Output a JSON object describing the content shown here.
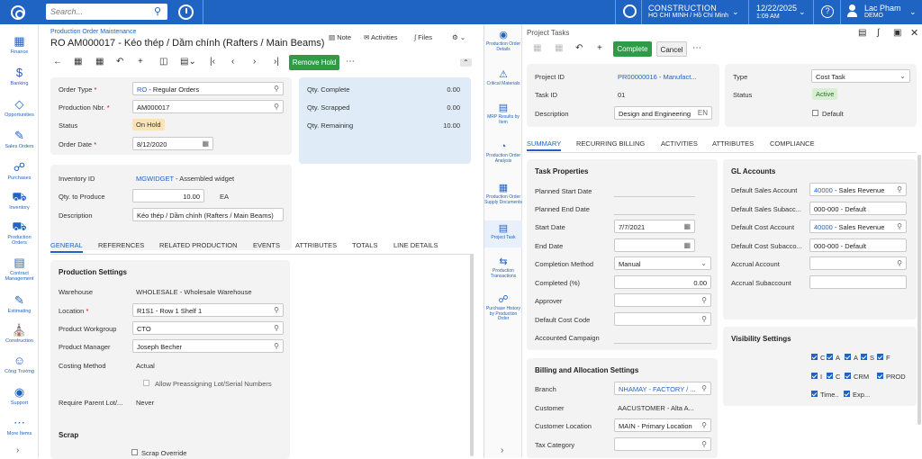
{
  "topbar": {
    "search_placeholder": "Search...",
    "company": "CONSTRUCTION",
    "branch": "HO CHI MINH / Hồ Chí Minh",
    "date": "12/22/2025",
    "time": "1:09 AM",
    "user_name": "Lac Pham",
    "user_role": "DEMO"
  },
  "sidebar": [
    {
      "label": "Finance",
      "icon": "finance-icon"
    },
    {
      "label": "Banking",
      "icon": "banking-icon"
    },
    {
      "label": "Opportunities",
      "icon": "opportunities-icon"
    },
    {
      "label": "Sales Orders",
      "icon": "sales-orders-icon"
    },
    {
      "label": "Purchases",
      "icon": "purchases-icon"
    },
    {
      "label": "Inventory",
      "icon": "inventory-icon"
    },
    {
      "label": "Production Orders",
      "icon": "production-orders-icon"
    },
    {
      "label": "Contract Management",
      "icon": "contract-icon"
    },
    {
      "label": "Estimating",
      "icon": "estimating-icon"
    },
    {
      "label": "Construction",
      "icon": "construction-icon"
    },
    {
      "label": "Công Trường",
      "icon": "site-icon"
    },
    {
      "label": "Support",
      "icon": "support-icon"
    },
    {
      "label": "More Items",
      "icon": "more-items-icon"
    }
  ],
  "main": {
    "breadcrumb": "Production Order Maintenance",
    "title": "RO AM000017 - Kéo thép / Dầm chính (Rafters / Main Beams)",
    "note_label": "Note",
    "activities_label": "Activities",
    "files_label": "Files",
    "remove_hold_label": "Remove Hold",
    "order_type_label": "Order Type",
    "order_type_code": "RO",
    "order_type_desc": " - Regular Orders",
    "production_nbr_label": "Production Nbr.",
    "production_nbr": "AM000017",
    "status_label": "Status",
    "status": "On Hold",
    "order_date_label": "Order Date",
    "order_date": "8/12/2020",
    "qty_complete_label": "Qty. Complete",
    "qty_complete": "0.00",
    "qty_scrapped_label": "Qty. Scrapped",
    "qty_scrapped": "0.00",
    "qty_remaining_label": "Qty. Remaining",
    "qty_remaining": "10.00",
    "inventory_id_label": "Inventory ID",
    "inventory_id_code": "MGWIDGET",
    "inventory_id_desc": " - Assembled widget",
    "qty_to_produce_label": "Qty. to Produce",
    "qty_to_produce": "10.00",
    "uom": "EA",
    "description_label": "Description",
    "description": "Kéo thép / Dầm chính (Rafters / Main Beams)",
    "tabs": [
      "GENERAL",
      "REFERENCES",
      "RELATED PRODUCTION",
      "EVENTS",
      "ATTRIBUTES",
      "TOTALS",
      "LINE DETAILS"
    ],
    "production_settings_title": "Production Settings",
    "warehouse_label": "Warehouse",
    "warehouse": "WHOLESALE - Wholesale Warehouse",
    "location_label": "Location",
    "location": "R1S1 - Row 1 Shelf 1",
    "product_workgroup_label": "Product Workgroup",
    "product_workgroup": "CTO",
    "product_manager_label": "Product Manager",
    "product_manager": "Joseph Becher",
    "costing_method_label": "Costing Method",
    "costing_method": "Actual",
    "allow_preassign_label": "Allow Preassigning Lot/Serial Numbers",
    "require_parent_label": "Require Parent Lot/...",
    "require_parent": "Never",
    "scrap_title": "Scrap",
    "scrap_override_label": "Scrap Override"
  },
  "rail": [
    {
      "label": "Production Order Details",
      "icon": "eye-icon"
    },
    {
      "label": "Critical Materials",
      "icon": "alert-icon"
    },
    {
      "label": "MRP Results by Item",
      "icon": "document-icon"
    },
    {
      "label": "Production Order Analysis",
      "icon": "gauge-icon"
    },
    {
      "label": "Production Order Supply Documents",
      "icon": "tree-icon"
    },
    {
      "label": "Project Task",
      "icon": "project-task-icon"
    },
    {
      "label": "Production Transactions",
      "icon": "transfer-icon"
    },
    {
      "label": "Purchase History by Production Order",
      "icon": "cart-icon"
    }
  ],
  "panel": {
    "title": "Project Tasks",
    "complete_label": "Complete",
    "cancel_label": "Cancel",
    "project_id_label": "Project ID",
    "project_id": "PR00000016 - Manufact...",
    "task_id_label": "Task ID",
    "task_id": "01",
    "description_label": "Description",
    "description": "Design and Engineering",
    "lang": "EN",
    "type_label": "Type",
    "type": "Cost Task",
    "status_label": "Status",
    "status": "Active",
    "default_label": "Default",
    "tabs": [
      "SUMMARY",
      "RECURRING BILLING",
      "ACTIVITIES",
      "ATTRIBUTES",
      "COMPLIANCE"
    ],
    "task_properties_title": "Task Properties",
    "planned_start_label": "Planned Start Date",
    "planned_end_label": "Planned End Date",
    "start_date_label": "Start Date",
    "start_date": "7/7/2021",
    "end_date_label": "End Date",
    "completion_method_label": "Completion Method",
    "completion_method": "Manual",
    "completed_label": "Completed (%)",
    "completed": "0.00",
    "approver_label": "Approver",
    "default_cost_code_label": "Default Cost Code",
    "accounted_campaign_label": "Accounted Campaign",
    "billing_title": "Billing and Allocation Settings",
    "branch_label": "Branch",
    "branch": "NHAMAY - FACTORY / ...",
    "customer_label": "Customer",
    "customer": "AACUSTOMER - Alta A...",
    "customer_location_label": "Customer Location",
    "customer_location": "MAIN - Primary Location",
    "tax_category_label": "Tax Category",
    "gl_title": "GL Accounts",
    "def_sales_account_label": "Default Sales Account",
    "def_sales_account_code": "40000",
    "def_sales_account_desc": " - Sales Revenue",
    "def_sales_sub_label": "Default Sales Subacc...",
    "def_sales_sub": "000-000 - Default",
    "def_cost_account_label": "Default Cost Account",
    "def_cost_account_code": "40000",
    "def_cost_account_desc": " - Sales Revenue",
    "def_cost_sub_label": "Default Cost Subacco...",
    "def_cost_sub": "000-000 - Default",
    "accrual_account_label": "Accrual Account",
    "accrual_sub_label": "Accrual Subaccount",
    "visibility_title": "Visibility Settings",
    "vis_row1": [
      "C",
      "A",
      "A",
      "S",
      "F"
    ],
    "vis_row2": [
      "I",
      "C",
      "CRM",
      "PROD"
    ],
    "vis_row3": [
      "Time..",
      "Exp..."
    ]
  }
}
